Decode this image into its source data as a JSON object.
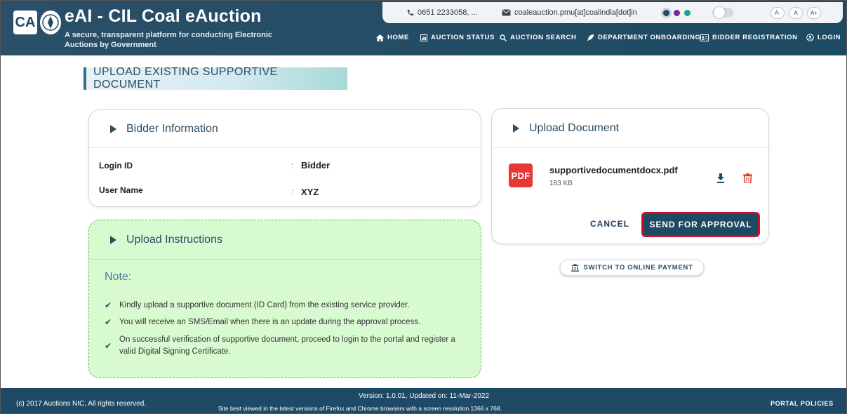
{
  "header": {
    "logo_text": "CA",
    "title": "eAI - CIL Coal eAuction",
    "subtitle": "A secure, transparent platform for conducting Electronic Auctions by Government",
    "phone": "0651 2233058, ...",
    "email": "coaleauction.pmu[at]coalindia[dot]in",
    "font_small": "A-",
    "font_normal": "A",
    "font_large": "A+",
    "theme_colors": [
      "#1d4a63",
      "#6a2d99",
      "#1aa39a"
    ]
  },
  "nav": {
    "home": "HOME",
    "auction_status": "AUCTION STATUS",
    "auction_search": "AUCTION SEARCH",
    "department_onboarding": "DEPARTMENT ONBOARDING",
    "bidder_registration": "BIDDER REGISTRATION",
    "login": "LOGIN"
  },
  "page": {
    "title": "UPLOAD EXISTING SUPPORTIVE DOCUMENT"
  },
  "bidder": {
    "heading": "Bidder Information",
    "login_id_label": "Login ID",
    "login_id_colon": ":",
    "login_id_value": "Bidder",
    "user_name_label": "User Name",
    "user_name_colon": ":",
    "user_name_value": "XYZ"
  },
  "upload": {
    "heading": "Upload Document",
    "file_icon": "PDF",
    "file_name": "supportivedocumentdocx.pdf",
    "file_size": "183 KB",
    "cancel_label": "CANCEL",
    "send_label": "SEND FOR APPROVAL"
  },
  "switch_label": "SWITCH TO ONLINE PAYMENT",
  "instructions": {
    "heading": "Upload Instructions",
    "note": "Note:",
    "items": [
      "Kindly upload a supportive document (ID Card) from the existing service provider.",
      "You will receive an SMS/Email when there is an update during the approval process.",
      "On successful verification of supportive document, proceed to login to the portal and register a valid Digital Signing Certificate."
    ]
  },
  "footer": {
    "copyright": "(c) 2017 Auctions NIC, All rights reserved.",
    "version": "Version: 1.0.01, Updated on: 11-Mar-2022",
    "best_viewed": "Site best viewed in the latest versions of Firefox and Chrome browsers with a screen resolution 1366 x 768.",
    "policies": "PORTAL POLICIES"
  }
}
